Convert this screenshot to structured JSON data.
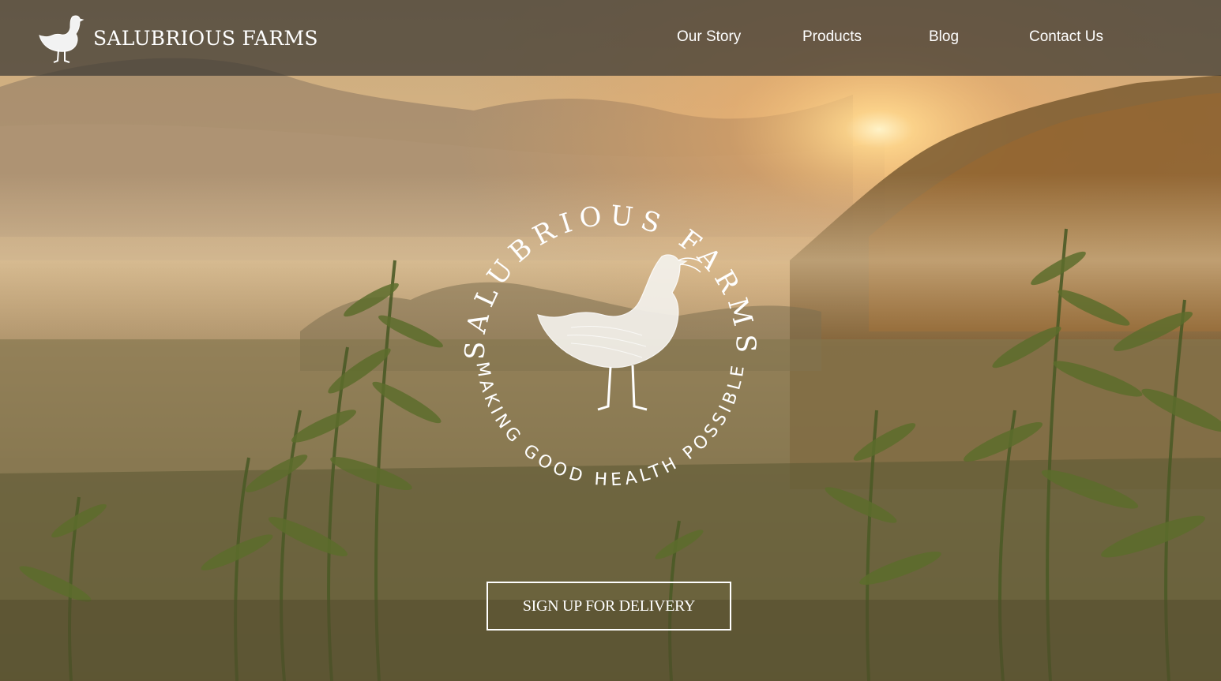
{
  "brand": {
    "name": "SALUBRIOUS FARMS",
    "logo_icon": "chicken-icon"
  },
  "nav": {
    "items": [
      {
        "label": "Our Story"
      },
      {
        "label": "Products"
      },
      {
        "label": "Blog"
      },
      {
        "label": "Contact Us"
      }
    ]
  },
  "emblem": {
    "top_text": "SALUBRIOUS FARMS",
    "bottom_text": "MAKING GOOD HEALTH POSSIBLE",
    "icon": "chicken-icon"
  },
  "cta": {
    "label": "SIGN UP FOR DELIVERY"
  },
  "colors": {
    "header_bg": "#3a3732",
    "text": "#ffffff",
    "sky_glow": "#f6c27a"
  }
}
